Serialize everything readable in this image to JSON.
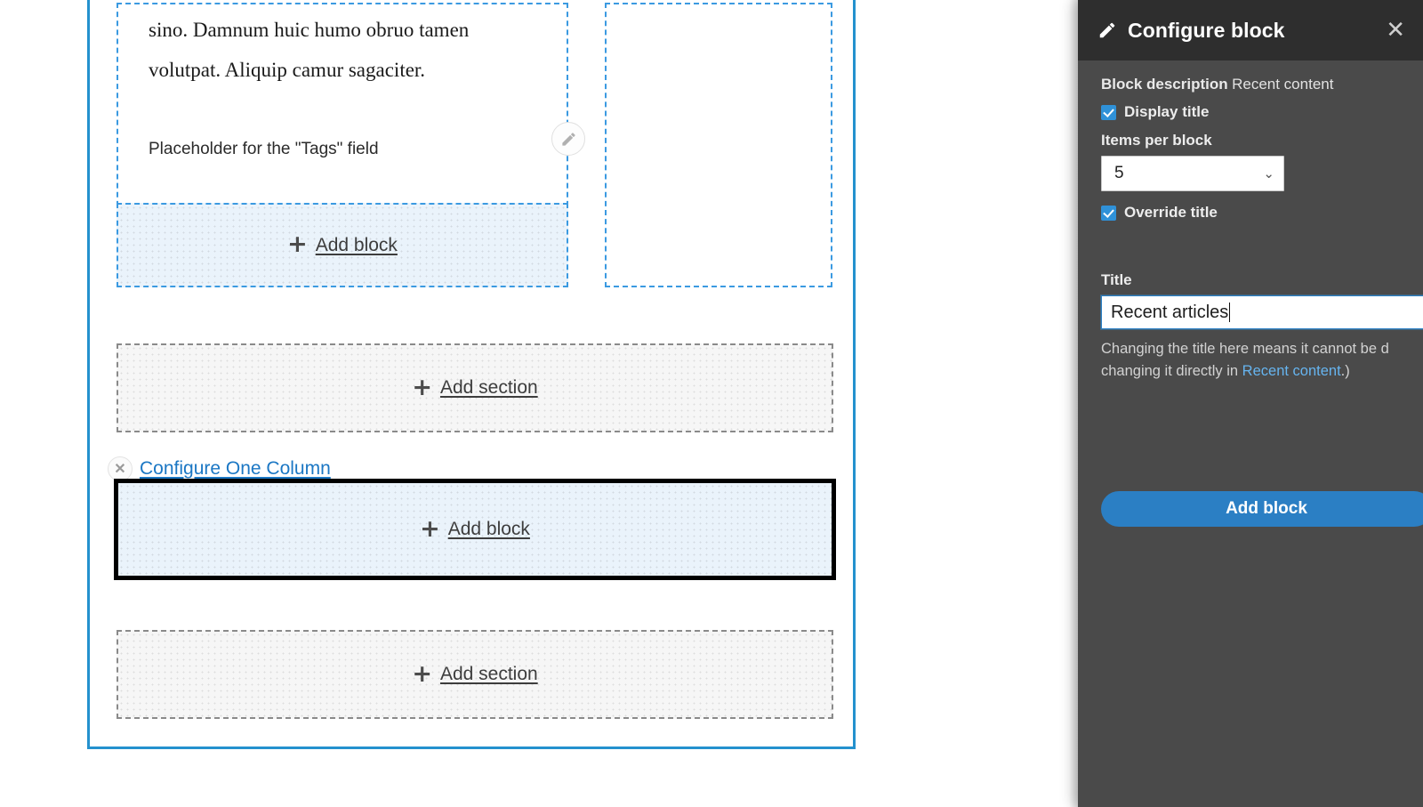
{
  "canvas": {
    "paragraph": "sino. Damnum huic humo obruo tamen volutpat. Aliquip camur sagaciter.",
    "tags_placeholder": "Placeholder for the \"Tags\" field",
    "edit_icon": "pencil-icon",
    "zones": {
      "add_block_column": {
        "label": "Add block",
        "plus": "+"
      },
      "add_section_top": {
        "label": "Add section",
        "plus": "+"
      },
      "add_block_selected": {
        "label": "Add block",
        "plus": "+"
      },
      "add_section_bottom": {
        "label": "Add section",
        "plus": "+"
      }
    },
    "configure_link": {
      "label": "Configure One Column",
      "badge_icon": "close-x-icon",
      "badge_glyph": "✕"
    }
  },
  "panel": {
    "title": "Configure block",
    "title_icon": "pencil-icon",
    "close_icon": "close-icon",
    "close_glyph": "✕",
    "block_description_label": "Block description",
    "block_description_value": "Recent content",
    "display_title_label": "Display title",
    "items_per_block_label": "Items per block",
    "items_per_block_value": "5",
    "items_per_block_options": [
      "5"
    ],
    "select_caret": "⌄",
    "override_title_label": "Override title",
    "title_field_label": "Title",
    "title_field_value": "Recent articles",
    "title_help_line1": "Changing the title here means it cannot be d",
    "title_help_line2_prefix": "changing it directly in ",
    "title_help_link": "Recent content",
    "title_help_line2_suffix": ".)",
    "add_block_button": "Add block"
  },
  "colors": {
    "panel_bg": "#4a4a4a",
    "panel_header_bg": "#2e2e2e",
    "accent_blue": "#2b7fc4",
    "frame_blue": "#2491ce",
    "dashed_blue": "#3b9ae1",
    "block_zone_bg": "#eaf3fb",
    "section_zone_bg": "#f6f6f6",
    "link_blue": "#1b77c4"
  }
}
